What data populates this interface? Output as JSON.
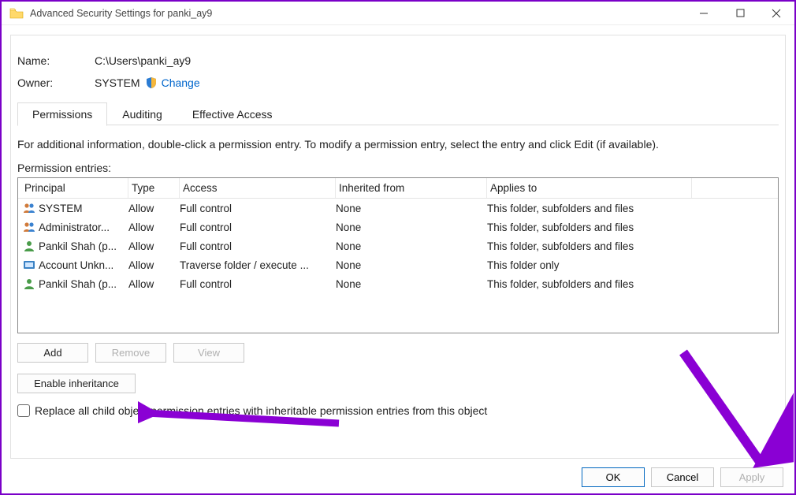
{
  "window": {
    "title": "Advanced Security Settings for panki_ay9"
  },
  "header": {
    "name_label": "Name:",
    "name_value": "C:\\Users\\panki_ay9",
    "owner_label": "Owner:",
    "owner_value": "SYSTEM",
    "change_link": "Change"
  },
  "tabs": [
    {
      "label": "Permissions",
      "active": true
    },
    {
      "label": "Auditing",
      "active": false
    },
    {
      "label": "Effective Access",
      "active": false
    }
  ],
  "info_text": "For additional information, double-click a permission entry. To modify a permission entry, select the entry and click Edit (if available).",
  "entries_label": "Permission entries:",
  "table": {
    "columns": [
      "Principal",
      "Type",
      "Access",
      "Inherited from",
      "Applies to"
    ],
    "rows": [
      {
        "icon": "group",
        "principal": "SYSTEM",
        "type": "Allow",
        "access": "Full control",
        "inherited": "None",
        "applies": "This folder, subfolders and files"
      },
      {
        "icon": "group",
        "principal": "Administrator...",
        "type": "Allow",
        "access": "Full control",
        "inherited": "None",
        "applies": "This folder, subfolders and files"
      },
      {
        "icon": "user",
        "principal": "Pankil Shah (p...",
        "type": "Allow",
        "access": "Full control",
        "inherited": "None",
        "applies": "This folder, subfolders and files"
      },
      {
        "icon": "unknown",
        "principal": "Account Unkn...",
        "type": "Allow",
        "access": "Traverse folder / execute ...",
        "inherited": "None",
        "applies": "This folder only"
      },
      {
        "icon": "user",
        "principal": "Pankil Shah (p...",
        "type": "Allow",
        "access": "Full control",
        "inherited": "None",
        "applies": "This folder, subfolders and files"
      }
    ]
  },
  "buttons": {
    "add": "Add",
    "remove": "Remove",
    "view": "View",
    "enable_inheritance": "Enable inheritance",
    "ok": "OK",
    "cancel": "Cancel",
    "apply": "Apply"
  },
  "checkbox": {
    "label": "Replace all child object permission entries with inheritable permission entries from this object",
    "checked": false
  }
}
